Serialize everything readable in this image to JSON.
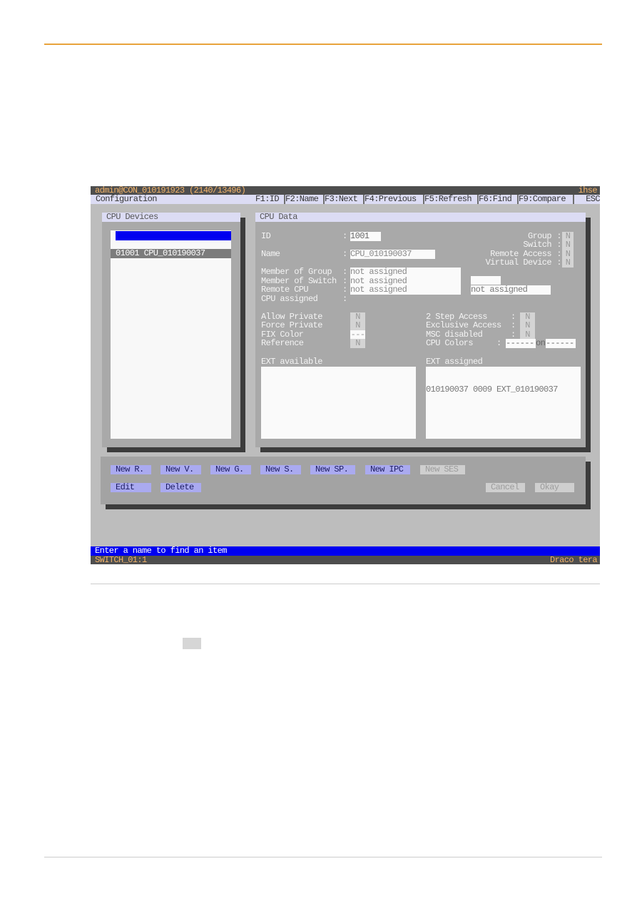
{
  "window": {
    "title": "admin@CON_010191923 (2140/13496)",
    "brand": "ihse"
  },
  "menu": {
    "context": "Configuration",
    "keys": [
      "F1:ID",
      "F2:Name",
      "F3:Next",
      "F4:Previous",
      "F5:Refresh",
      "F6:Find",
      "F9:Compare",
      "ESC"
    ]
  },
  "devices": {
    "title": "CPU Devices",
    "search_value": "",
    "items": [
      "01001 CPU_010190037"
    ],
    "selected": 0
  },
  "cpu_data": {
    "title": "CPU Data",
    "id_label": "ID",
    "id": "1001",
    "name_label": "Name",
    "name": "CPU_010190037",
    "flags": [
      {
        "label": "Group",
        "value": "N"
      },
      {
        "label": "Switch",
        "value": "N"
      },
      {
        "label": "Remote Access",
        "value": "N"
      },
      {
        "label": "Virtual Device",
        "value": "N"
      }
    ],
    "member_group_label": "Member of Group",
    "member_group": "not assigned",
    "member_switch_label": "Member of Switch",
    "member_switch": "not assigned",
    "remote_cpu_label": "Remote CPU",
    "remote_cpu": "not assigned",
    "remote_cpu_2": "not assigned",
    "cpu_assigned_label": "CPU assigned",
    "left_opts": [
      {
        "label": "Allow Private",
        "value": "N"
      },
      {
        "label": "Force Private",
        "value": "N"
      },
      {
        "label": "FIX Color",
        "value": "---"
      },
      {
        "label": "Reference",
        "value": "N"
      }
    ],
    "right_opts": [
      {
        "label": "2 Step Access",
        "value": "N"
      },
      {
        "label": "Exclusive Access",
        "value": "N"
      },
      {
        "label": "MSC disabled",
        "value": "N"
      }
    ],
    "cpu_colors_label": "CPU Colors",
    "cpu_colors_a": "------",
    "cpu_colors_on": "on",
    "cpu_colors_b": "------",
    "ext_available_label": "EXT available",
    "ext_available": [],
    "ext_assigned_label": "EXT assigned",
    "ext_assigned": [
      "010190037 0009 EXT_010190037"
    ]
  },
  "buttons": {
    "new_r": "New R.",
    "new_v": "New V.",
    "new_g": "New G.",
    "new_s": "New S.",
    "new_sp": "New SP.",
    "new_ipc": "New IPC",
    "new_ses": "New SES",
    "edit": "Edit",
    "delete": "Delete",
    "cancel": "Cancel",
    "okay": "Okay"
  },
  "status": {
    "message": "Enter a name to find an item",
    "switch": "SWITCH_01:1",
    "product": "Draco tera"
  },
  "colors": {
    "accent_line": "#e8a33c",
    "status_blue": "#0000f0",
    "button": "#aaaaf0"
  }
}
